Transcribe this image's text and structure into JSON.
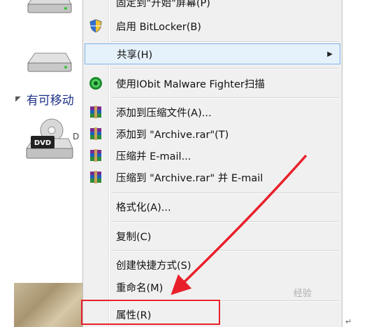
{
  "explorer": {
    "section_header": "有可移动",
    "drive_label_fragment": "",
    "dvd_badge": "DVD",
    "dvd_label_fragment": "D"
  },
  "context_menu": {
    "items": [
      {
        "label": "固定到\"开始\"屏幕(P)",
        "icon": "none"
      },
      {
        "label": "启用 BitLocker(B)",
        "icon": "shield-icon"
      },
      {
        "label": "共享(H)",
        "icon": "none",
        "submenu": true,
        "highlighted": true
      },
      {
        "label": "使用IObit Malware Fighter扫描",
        "icon": "iobit-icon"
      },
      {
        "label": "添加到压缩文件(A)...",
        "icon": "winrar-icon"
      },
      {
        "label": "添加到 \"Archive.rar\"(T)",
        "icon": "winrar-icon"
      },
      {
        "label": "压缩并 E-mail...",
        "icon": "winrar-icon"
      },
      {
        "label": "压缩到 \"Archive.rar\" 并 E-mail",
        "icon": "winrar-icon"
      },
      {
        "label": "格式化(A)...",
        "icon": "none"
      },
      {
        "label": "复制(C)",
        "icon": "none"
      },
      {
        "label": "创建快捷方式(S)",
        "icon": "none"
      },
      {
        "label": "重命名(M)",
        "icon": "none"
      },
      {
        "label": "属性(R)",
        "icon": "none"
      }
    ],
    "submenu_arrow": "▶"
  },
  "annotation": {
    "highlight_color": "#e8202a"
  },
  "watermark": "经验",
  "return_mark": "↵"
}
